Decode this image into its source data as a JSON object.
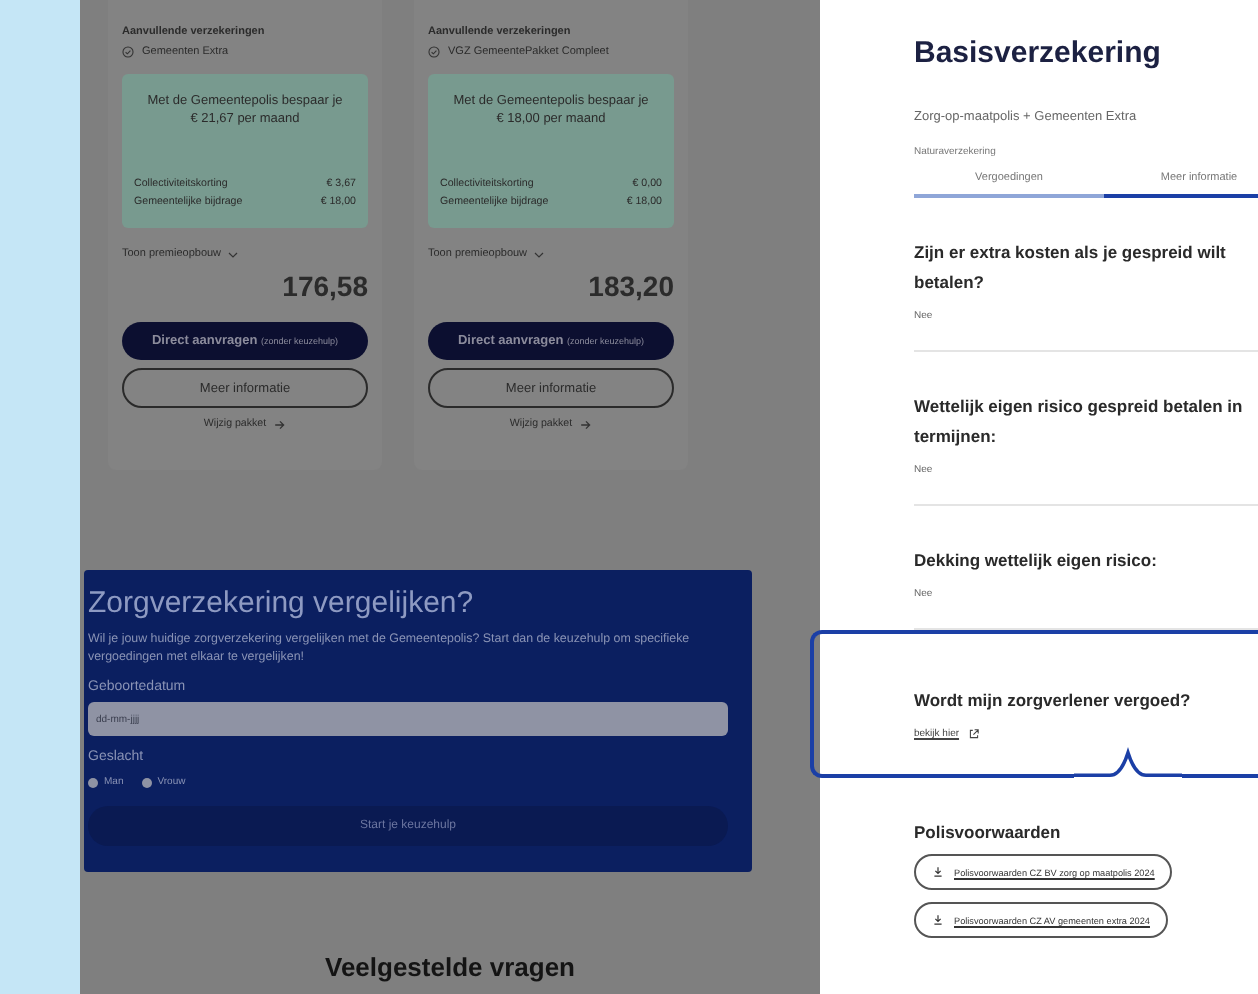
{
  "background_page": {
    "cards": [
      {
        "supplementary_label": "Aanvullende verzekeringen",
        "package": "Gemeenten Extra",
        "savings_line": "Met de Gemeentepolis bespaar je",
        "savings_amount": "€ 21,67 per maand",
        "discounts": [
          {
            "label": "Collectiviteitskorting",
            "value": "€ 3,67"
          },
          {
            "label": "Gemeentelijke bijdrage",
            "value": "€ 18,00"
          }
        ],
        "premium_toggle": "Toon premieopbouw",
        "price": "176,58",
        "apply_button": "Direct aanvragen",
        "apply_note": "(zonder keuzehulp)",
        "info_button": "Meer informatie",
        "change_link": "Wijzig pakket"
      },
      {
        "supplementary_label": "Aanvullende verzekeringen",
        "package": "VGZ GemeentePakket Compleet",
        "savings_line": "Met de Gemeentepolis bespaar je",
        "savings_amount": "€ 18,00 per maand",
        "discounts": [
          {
            "label": "Collectiviteitskorting",
            "value": "€ 0,00"
          },
          {
            "label": "Gemeentelijke bijdrage",
            "value": "€ 18,00"
          }
        ],
        "premium_toggle": "Toon premieopbouw",
        "price": "183,20",
        "apply_button": "Direct aanvragen",
        "apply_note": "(zonder keuzehulp)",
        "info_button": "Meer informatie",
        "change_link": "Wijzig pakket"
      }
    ],
    "compare": {
      "title": "Zorgverzekering vergelijken?",
      "description": "Wil je jouw huidige zorgverzekering vergelijken met de Gemeentepolis? Start dan de keuzehulp om specifieke vergoedingen met elkaar te vergelijken!",
      "birthdate_label": "Geboortedatum",
      "birthdate": {
        "placeholder": "dd-mm-jjjj"
      },
      "gender_label": "Geslacht",
      "genders": [
        {
          "label": "Man",
          "selected": false
        },
        {
          "label": "Vrouw",
          "selected": false
        }
      ],
      "start_button": {
        "label": "Start je keuzehulp",
        "disabled": true
      }
    },
    "faq_heading": "Veelgestelde vragen"
  },
  "panel": {
    "title": "Basisverzekering",
    "subtitle": "Zorg-op-maatpolis + Gemeenten Extra",
    "policy_type": "Naturaverzekering",
    "tabs": [
      {
        "label": "Vergoedingen",
        "selected": false
      },
      {
        "label": "Meer informatie",
        "selected": true
      }
    ],
    "questions": [
      {
        "question": "Zijn er extra kosten als je gespreid wilt betalen?",
        "answer": "Nee",
        "highlighted": false
      },
      {
        "question": "Wettelijk eigen risico gespreid betalen in termijnen:",
        "answer": "Nee",
        "highlighted": false
      },
      {
        "question": "Dekking wettelijk eigen risico:",
        "answer": "Nee",
        "highlighted": false
      },
      {
        "question": "Wordt mijn zorgverlener vergoed?",
        "link": "bekijk hier",
        "highlighted": true
      }
    ],
    "documents_title": "Polisvoorwaarden",
    "documents": [
      "Polisvoorwaarden CZ BV zorg op maatpolis 2024",
      "Polisvoorwaarden CZ AV gemeenten extra 2024"
    ]
  }
}
